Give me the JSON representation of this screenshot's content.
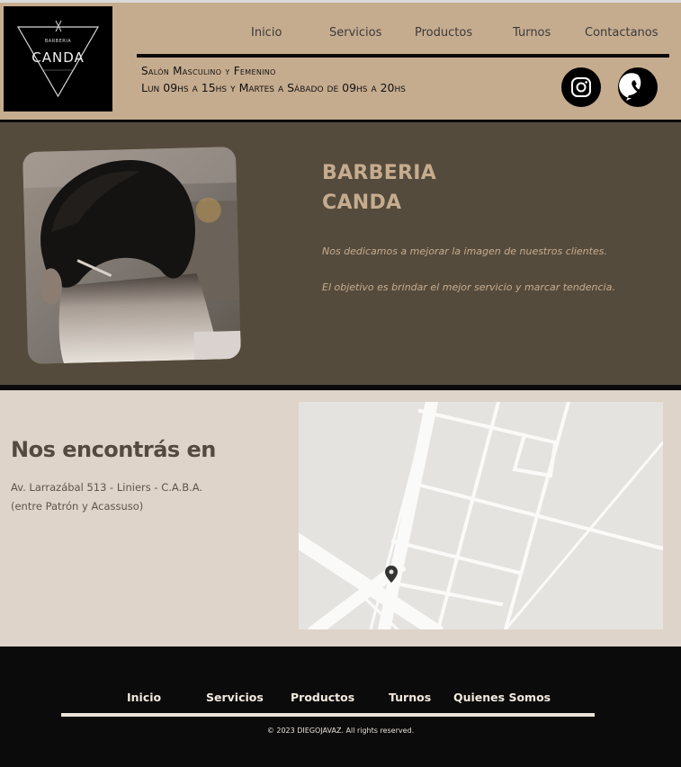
{
  "header": {
    "logo": {
      "top": "BARBERIA",
      "name": "CANDA",
      "est": "EST"
    },
    "nav": [
      "Inicio",
      "Servicios",
      "Productos",
      "Turnos",
      "Contactanos"
    ],
    "tagline": "Salón Masculino y Femenino",
    "hours": "Lun 09hs a 15hs y Martes a Sábado de 09hs a 20hs",
    "social": {
      "instagram": "instagram-icon",
      "whatsapp": "whatsapp-icon"
    }
  },
  "hero": {
    "title_line1": "BARBERIA",
    "title_line2": "CANDA",
    "lines": [
      "Nos dedicamos a mejorar la imagen de nuestros clientes.",
      "El objetivo es brindar el mejor servicio y marcar tendencia."
    ]
  },
  "location": {
    "title": "Nos encontrás en",
    "address": "Av. Larrazábal 513 - Liniers - C.A.B.A.",
    "between": "(entre Patrón y Acassuso)",
    "map_pin": "map-pin-icon"
  },
  "footer": {
    "nav": [
      "Inicio",
      "Servicios",
      "Productos",
      "Turnos",
      "Quienes Somos"
    ],
    "copyright": "© 2023 DIEGOJAVAZ.  All rights reserved."
  },
  "colors": {
    "header_bg": "#c6ac8f",
    "hero_bg": "#554b3c",
    "accent": "#c6ac8f",
    "location_bg": "#ded4ca",
    "footer_bg": "#0b0b0b"
  }
}
